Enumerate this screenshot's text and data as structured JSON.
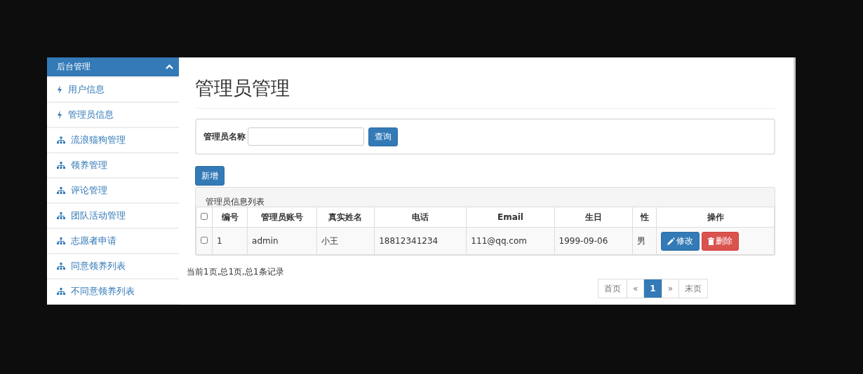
{
  "sidebar": {
    "title": "后台管理",
    "expanded": true,
    "items": [
      {
        "label": "用户信息",
        "kind": "bolt"
      },
      {
        "label": "管理员信息",
        "kind": "bolt"
      },
      {
        "label": "流浪猫狗管理",
        "kind": "sitemap"
      },
      {
        "label": "领养管理",
        "kind": "sitemap"
      },
      {
        "label": "评论管理",
        "kind": "sitemap"
      },
      {
        "label": "团队活动管理",
        "kind": "sitemap"
      },
      {
        "label": "志愿者申请",
        "kind": "sitemap"
      },
      {
        "label": "同意领养列表",
        "kind": "sitemap"
      },
      {
        "label": "不同意领养列表",
        "kind": "sitemap"
      }
    ]
  },
  "page_title": "管理员管理",
  "search": {
    "label": "管理员名称",
    "button": "查询"
  },
  "add_button": "新增",
  "table": {
    "caption": "管理员信息列表",
    "all_checked": false,
    "columns": [
      "编号",
      "管理员账号",
      "真实姓名",
      "电话",
      "Email",
      "生日",
      "性",
      "操作"
    ],
    "rows": [
      {
        "checked": false,
        "cells": [
          "1",
          "admin",
          "小王",
          "18812341234",
          "111@qq.com",
          "1999-09-06",
          "男"
        ],
        "edit": "修改",
        "delete": "删除"
      }
    ]
  },
  "footer": {
    "summary": "当前1页,总1页,总1条记录",
    "pages": [
      {
        "label": "首页",
        "selected": false
      },
      {
        "label": "«",
        "selected": false
      },
      {
        "label": "1",
        "selected": true
      },
      {
        "label": "»",
        "selected": false
      },
      {
        "label": "末页",
        "selected": false
      }
    ]
  }
}
